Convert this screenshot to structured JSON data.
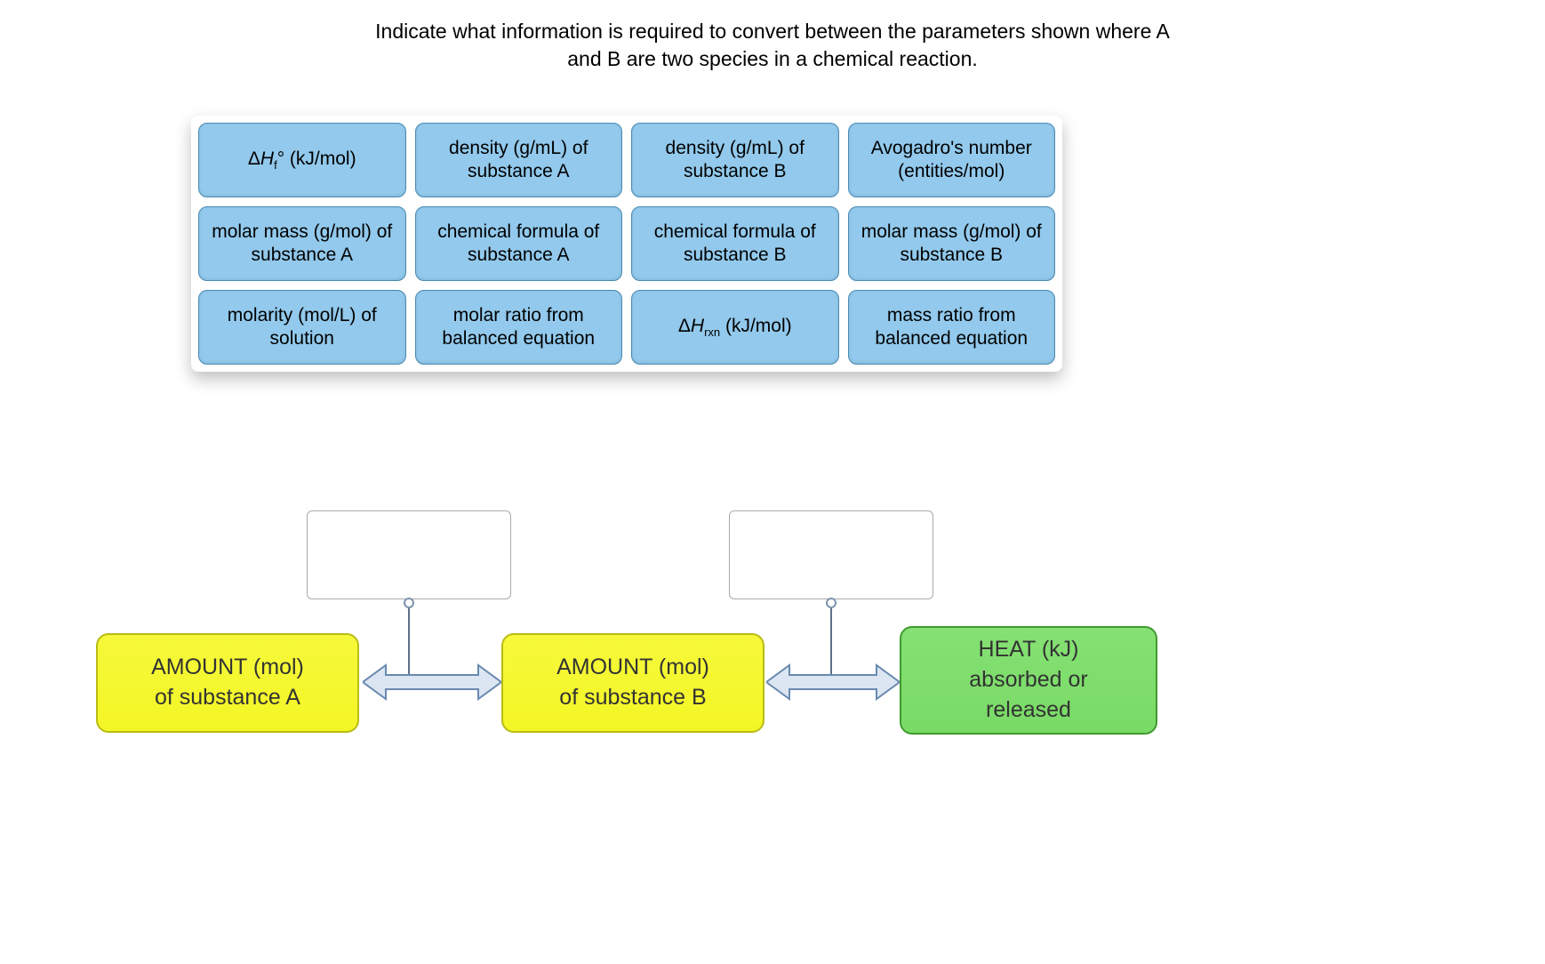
{
  "question_line1": "Indicate what information is required to convert between the parameters shown where A",
  "question_line2": "and B are two species in a chemical reaction.",
  "choices": {
    "r0c0_html": "Δ<span class='italic'>H</span><span class='sub'>f</span>° (kJ/mol)",
    "r0c1": "density (g/mL) of substance A",
    "r0c2": "density (g/mL) of substance B",
    "r0c3": "Avogadro's number (entities/mol)",
    "r1c0": "molar mass (g/mol) of substance A",
    "r1c1": "chemical formula of substance A",
    "r1c2": "chemical formula of substance B",
    "r1c3": "molar mass (g/mol) of substance B",
    "r2c0": "molarity (mol/L) of solution",
    "r2c1": "molar ratio from balanced equation",
    "r2c2_html": "Δ<span class='italic'>H</span><span class='sub'>rxn</span> (kJ/mol)",
    "r2c3": "mass ratio from balanced equation"
  },
  "boxes": {
    "a_line1": "AMOUNT (mol)",
    "a_line2": "of substance A",
    "b_line1": "AMOUNT (mol)",
    "b_line2": "of substance B",
    "c_line1": "HEAT (kJ)",
    "c_line2": "absorbed or",
    "c_line3": "released"
  }
}
